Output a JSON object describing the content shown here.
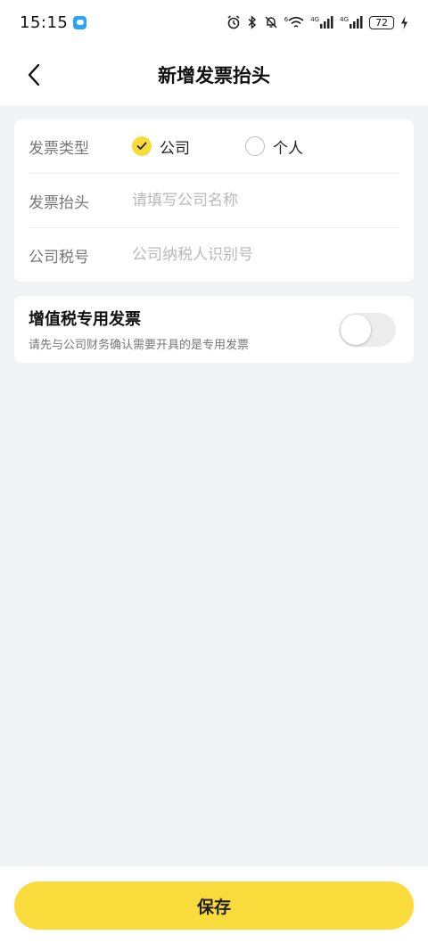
{
  "status_bar": {
    "time": "15:15",
    "battery": "72",
    "signal_label_1": "4G",
    "signal_label_2": "4G",
    "wifi_label": "6"
  },
  "nav": {
    "title": "新增发票抬头"
  },
  "form": {
    "type_label": "发票类型",
    "type_options": [
      {
        "label": "公司",
        "checked": true
      },
      {
        "label": "个人",
        "checked": false
      }
    ],
    "title_label": "发票抬头",
    "title_placeholder": "请填写公司名称",
    "tax_label": "公司税号",
    "tax_placeholder": "公司纳税人识别号"
  },
  "vat": {
    "title": "增值税专用发票",
    "description": "请先与公司财务确认需要开具的是专用发票",
    "enabled": false
  },
  "footer": {
    "save_label": "保存"
  },
  "colors": {
    "accent": "#fadb3c",
    "background": "#f2f3f5"
  }
}
